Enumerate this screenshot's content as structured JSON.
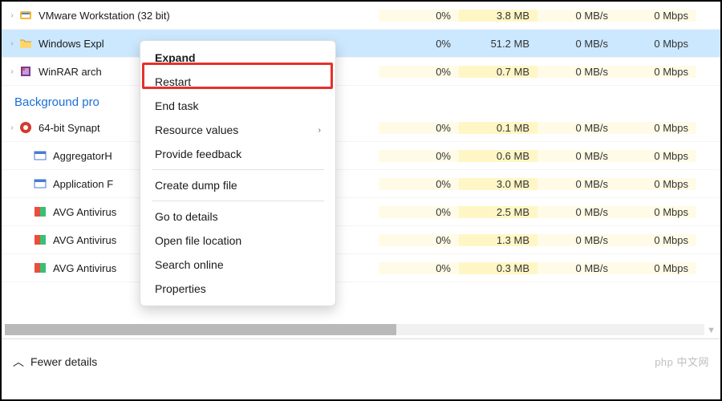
{
  "columns": [
    "cpu",
    "mem",
    "disk",
    "net"
  ],
  "rows": [
    {
      "expand": true,
      "icon": "vmware",
      "name": "VMware Workstation (32 bit)",
      "cpu": "0%",
      "mem": "3.8 MB",
      "disk": "0 MB/s",
      "net": "0 Mbps",
      "selected": false
    },
    {
      "expand": true,
      "icon": "folder",
      "name": "Windows Expl",
      "cpu": "0%",
      "mem": "51.2 MB",
      "disk": "0 MB/s",
      "net": "0 Mbps",
      "selected": true
    },
    {
      "expand": true,
      "icon": "winrar",
      "name": "WinRAR arch",
      "cpu": "0%",
      "mem": "0.7 MB",
      "disk": "0 MB/s",
      "net": "0 Mbps",
      "selected": false
    }
  ],
  "section_header": "Background pro",
  "bg_rows": [
    {
      "expand": true,
      "icon": "synaptics",
      "name": "64-bit Synapt",
      "cpu": "0%",
      "mem": "0.1 MB",
      "disk": "0 MB/s",
      "net": "0 Mbps"
    },
    {
      "expand": false,
      "icon": "panel",
      "name": "AggregatorH",
      "cpu": "0%",
      "mem": "0.6 MB",
      "disk": "0 MB/s",
      "net": "0 Mbps"
    },
    {
      "expand": false,
      "icon": "panel",
      "name": "Application F",
      "cpu": "0%",
      "mem": "3.0 MB",
      "disk": "0 MB/s",
      "net": "0 Mbps"
    },
    {
      "expand": false,
      "icon": "avg",
      "name": "AVG Antivirus",
      "cpu": "0%",
      "mem": "2.5 MB",
      "disk": "0 MB/s",
      "net": "0 Mbps"
    },
    {
      "expand": false,
      "icon": "avg",
      "name": "AVG Antivirus",
      "cpu": "0%",
      "mem": "1.3 MB",
      "disk": "0 MB/s",
      "net": "0 Mbps"
    },
    {
      "expand": false,
      "icon": "avg",
      "name": "AVG Antivirus",
      "cpu": "0%",
      "mem": "0.3 MB",
      "disk": "0 MB/s",
      "net": "0 Mbps"
    }
  ],
  "context_menu": {
    "items": [
      {
        "label": "Expand",
        "bold": true
      },
      {
        "label": "Restart"
      },
      {
        "label": "End task"
      },
      {
        "label": "Resource values",
        "submenu": true
      },
      {
        "label": "Provide feedback"
      },
      {
        "sep": true
      },
      {
        "label": "Create dump file"
      },
      {
        "sep": true
      },
      {
        "label": "Go to details"
      },
      {
        "label": "Open file location"
      },
      {
        "label": "Search online"
      },
      {
        "label": "Properties"
      }
    ]
  },
  "footer": {
    "fewer_details": "Fewer details",
    "watermark": "php 中文网"
  }
}
